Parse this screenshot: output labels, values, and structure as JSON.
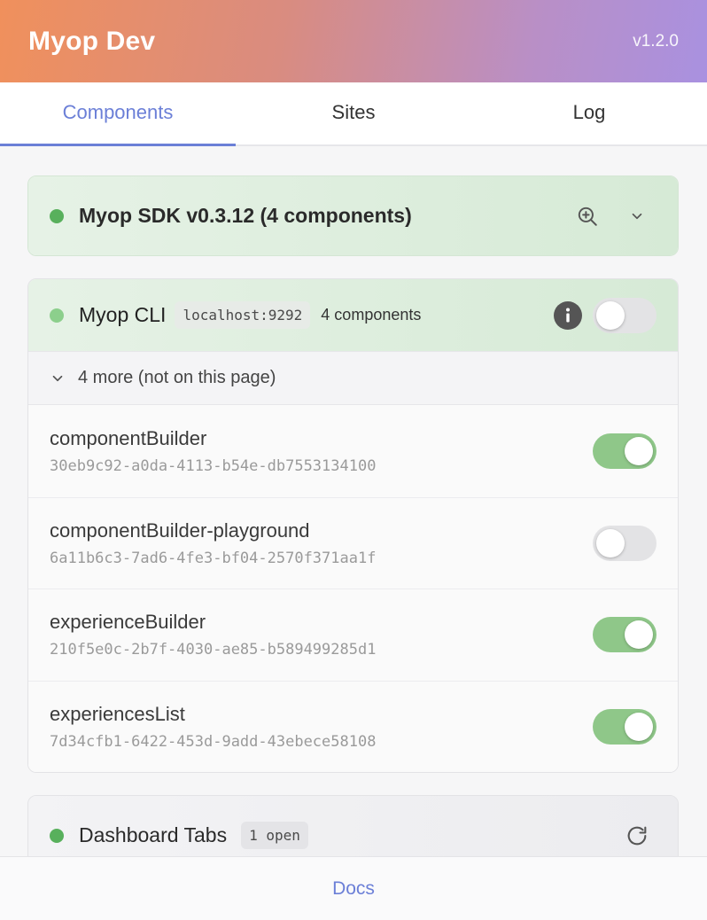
{
  "header": {
    "title": "Myop Dev",
    "version": "v1.2.0"
  },
  "tabs": [
    {
      "label": "Components",
      "active": true
    },
    {
      "label": "Sites",
      "active": false
    },
    {
      "label": "Log",
      "active": false
    }
  ],
  "sdk": {
    "title": "Myop SDK v0.3.12 (4 components)",
    "status_color": "#58b05c"
  },
  "cli": {
    "title": "Myop CLI",
    "host": "localhost:9292",
    "count": "4 components",
    "enabled": false,
    "more_label": "4 more (not on this page)",
    "components": [
      {
        "name": "componentBuilder",
        "id": "30eb9c92-a0da-4113-b54e-db7553134100",
        "enabled": true
      },
      {
        "name": "componentBuilder-playground",
        "id": "6a11b6c3-7ad6-4fe3-bf04-2570f371aa1f",
        "enabled": false
      },
      {
        "name": "experienceBuilder",
        "id": "210f5e0c-2b7f-4030-ae85-b589499285d1",
        "enabled": true
      },
      {
        "name": "experiencesList",
        "id": "7d34cfb1-6422-453d-9add-43ebece58108",
        "enabled": true
      }
    ]
  },
  "dashboard": {
    "title": "Dashboard Tabs",
    "badge": "1 open"
  },
  "footer": {
    "docs_label": "Docs"
  },
  "colors": {
    "accent": "#6b7fd7",
    "toggle_on": "#8fc789",
    "status_green": "#58b05c"
  },
  "icons": {
    "sdk_action": "zoom-in-icon",
    "sdk_expand": "chevron-down-icon",
    "cli_info": "info-icon",
    "more_expand": "chevron-down-icon",
    "dashboard_refresh": "refresh-icon"
  }
}
